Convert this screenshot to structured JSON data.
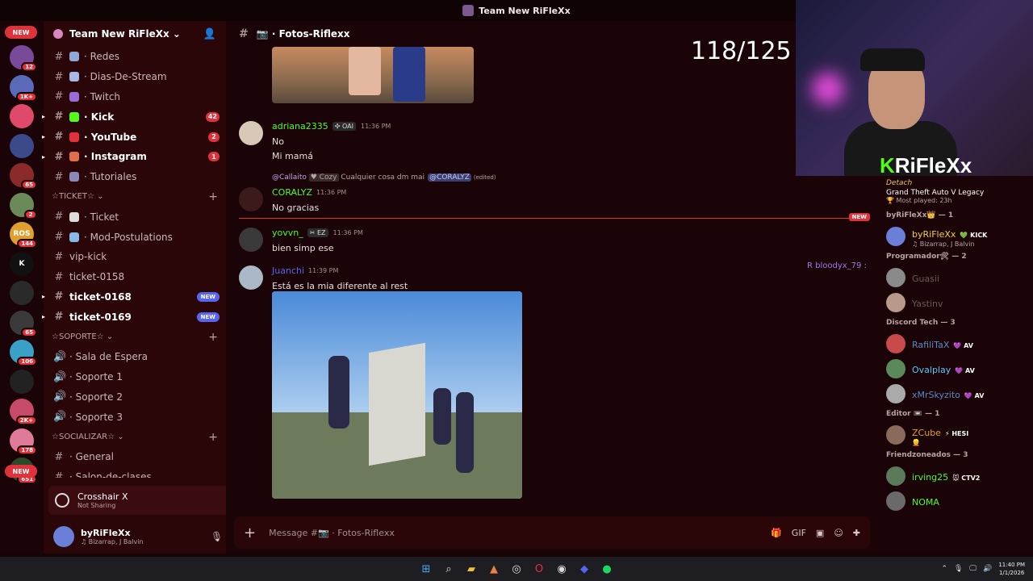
{
  "window": {
    "title": "Team New RiFleXx"
  },
  "servers": [
    {
      "label": "",
      "badge": "12",
      "color": "#7a4a9a"
    },
    {
      "label": "",
      "badge": "1K+",
      "color": "#5a6ab8"
    },
    {
      "label": "",
      "badge": "",
      "color": "#e04a6a"
    },
    {
      "label": "",
      "badge": "",
      "color": "#3a4a8a"
    },
    {
      "label": "",
      "badge": "65",
      "color": "#8a2a2a"
    },
    {
      "label": "",
      "badge": "2",
      "color": "#6a8a5a"
    },
    {
      "label": "ROS",
      "badge": "144",
      "color": "#e0a030"
    },
    {
      "label": "K",
      "badge": "",
      "color": "#111111"
    },
    {
      "label": "",
      "badge": "",
      "color": "#2a2a2a"
    },
    {
      "label": "",
      "badge": "65",
      "color": "#3a3a3a"
    },
    {
      "label": "",
      "badge": "106",
      "color": "#3aa0c8"
    },
    {
      "label": "",
      "badge": "",
      "color": "#222222"
    },
    {
      "label": "",
      "badge": "2K+",
      "color": "#c84a6a"
    },
    {
      "label": "",
      "badge": "178",
      "color": "#e07a9a"
    },
    {
      "label": "",
      "badge": "651",
      "color": "#2a4a2a"
    }
  ],
  "rail_new_top": "NEW",
  "rail_new_bottom": "NEW",
  "guild": {
    "name": "Team New RiFleXx ⌄"
  },
  "channels_top": [
    {
      "name": "· Redes",
      "bold": false,
      "count": "",
      "color": "#8fa8d8"
    },
    {
      "name": "· Dias-De-Stream",
      "bold": false,
      "count": "",
      "color": "#a8b8e8"
    },
    {
      "name": "· Twitch",
      "bold": false,
      "count": "",
      "color": "#9b6bd8"
    },
    {
      "name": "· Kick",
      "bold": true,
      "count": "42",
      "color": "#53fc18"
    },
    {
      "name": "· YouTube",
      "bold": true,
      "count": "2",
      "color": "#e0323a"
    },
    {
      "name": "· Instagram",
      "bold": true,
      "count": "1",
      "color": "#e0704a"
    },
    {
      "name": "· Tutoriales",
      "bold": false,
      "count": "",
      "color": "#8a8ab8"
    }
  ],
  "cat_ticket": "☆TICKET☆ ⌄",
  "channels_ticket": [
    {
      "name": "· Ticket",
      "bold": false,
      "newtag": "",
      "emo": "#dddddd"
    },
    {
      "name": "· Mod-Postulations",
      "bold": false,
      "newtag": "",
      "emo": "#8ab8e8"
    },
    {
      "name": "vip-kick",
      "bold": false,
      "newtag": "",
      "emo": ""
    },
    {
      "name": "ticket-0158",
      "bold": false,
      "newtag": "",
      "emo": ""
    },
    {
      "name": "ticket-0168",
      "bold": true,
      "newtag": "NEW",
      "emo": ""
    },
    {
      "name": "ticket-0169",
      "bold": true,
      "newtag": "NEW",
      "emo": ""
    }
  ],
  "cat_soporte": "☆SOPORTE☆ ⌄",
  "channels_soporte": [
    {
      "name": "· Sala de Espera"
    },
    {
      "name": "· Soporte 1"
    },
    {
      "name": "· Soporte 2"
    },
    {
      "name": "· Soporte 3"
    }
  ],
  "cat_social": "☆SOCIALIZAR☆ ⌄",
  "channels_social": [
    {
      "name": "· General"
    },
    {
      "name": "· Salon-de-clases"
    }
  ],
  "game_panel": {
    "title": "Crosshair X",
    "status": "Not Sharing"
  },
  "user_panel": {
    "name": "byRiFleXx",
    "status": "♫ Bizarrap, J Balvin"
  },
  "chat": {
    "channel": "📷 · Fotos-Riflexx",
    "counter": "118/125",
    "messages": [
      {
        "name": "adriana2335",
        "tag": "✣ OAI",
        "time": "11:36 PM",
        "lines": [
          "No",
          "Mi mamá"
        ],
        "color": "#53fc18"
      },
      {
        "name": "CORALYZ",
        "tag": "",
        "time": "11:36 PM",
        "lines": [
          "No gracias"
        ],
        "color": "#53fc18"
      },
      {
        "name": "yovvn_",
        "tag": "✂ EZ",
        "time": "11:36 PM",
        "lines": [
          "bien simp ese"
        ],
        "color": "#53fc18"
      },
      {
        "name": "Juanchi",
        "tag": "",
        "time": "11:39 PM",
        "lines": [
          "Está es la mia diferente al rest"
        ],
        "color": "#5865f2"
      }
    ],
    "reply": {
      "user": "@Callaito",
      "tag": "♥ Cozy",
      "text": "Cualquier cosa dm mai",
      "mention": "@CORALYZ",
      "edited": "(edited)"
    },
    "new_label": "NEW",
    "typing": "R bloodyx_79 :",
    "composer_placeholder": "Message #📷 · Fotos-Riflexx"
  },
  "stream": {
    "logo_k": "K",
    "logo_text": "RiFleXx"
  },
  "members": {
    "activity": {
      "detached": "Detach",
      "game": "Grand Theft Auto V Legacy",
      "played": "🏆 Most played: 23h"
    },
    "sections": [
      {
        "title": "byRiFleXx👑 — 1",
        "items": [
          {
            "name": "byRiFleXx",
            "tag": "💚 KICK",
            "sub": "♫ Bizarrap, J Balvin",
            "color": "#f0d040",
            "av": "#6b7fd8"
          }
        ]
      },
      {
        "title": "Programador🛠 — 2",
        "items": [
          {
            "name": "Guasii",
            "tag": "",
            "sub": "",
            "color": "#6a5a5a",
            "av": "#8a8a8a"
          },
          {
            "name": "Yastinv",
            "tag": "",
            "sub": "",
            "color": "#6a5a5a",
            "av": "#b89a8a"
          }
        ]
      },
      {
        "title": "Discord Tech — 3",
        "items": [
          {
            "name": "RafiliTaX",
            "tag": "💜 AV",
            "sub": "",
            "color": "#5a8ac8",
            "av": "#c84a4a"
          },
          {
            "name": "Ovalplay",
            "tag": "💜 AV",
            "sub": "",
            "color": "#5ac8f8",
            "av": "#5a8a5a"
          },
          {
            "name": "xMrSkyzito",
            "tag": "💜 AV",
            "sub": "",
            "color": "#5a8ac8",
            "av": "#aaaaaa"
          }
        ]
      },
      {
        "title": "Editor 📼 — 1",
        "items": [
          {
            "name": "ZCube",
            "tag": "⚡ HESI",
            "sub": "👱",
            "color": "#e0a030",
            "av": "#8a6a5a"
          }
        ]
      },
      {
        "title": "Friendzoneados — 3",
        "items": [
          {
            "name": "irving25",
            "tag": "🐭 CTV2",
            "sub": "",
            "color": "#53fc18",
            "av": "#5a7a5a"
          },
          {
            "name": "NOMA",
            "tag": "",
            "sub": "",
            "color": "#53fc18",
            "av": "#6a6a6a"
          }
        ]
      }
    ]
  },
  "taskbar": {
    "time": "11:40 PM",
    "date": "1/1/2026"
  },
  "colors": {
    "accent_red": "#e0323a",
    "kick_green": "#53fc18",
    "blurple": "#5865f2"
  }
}
